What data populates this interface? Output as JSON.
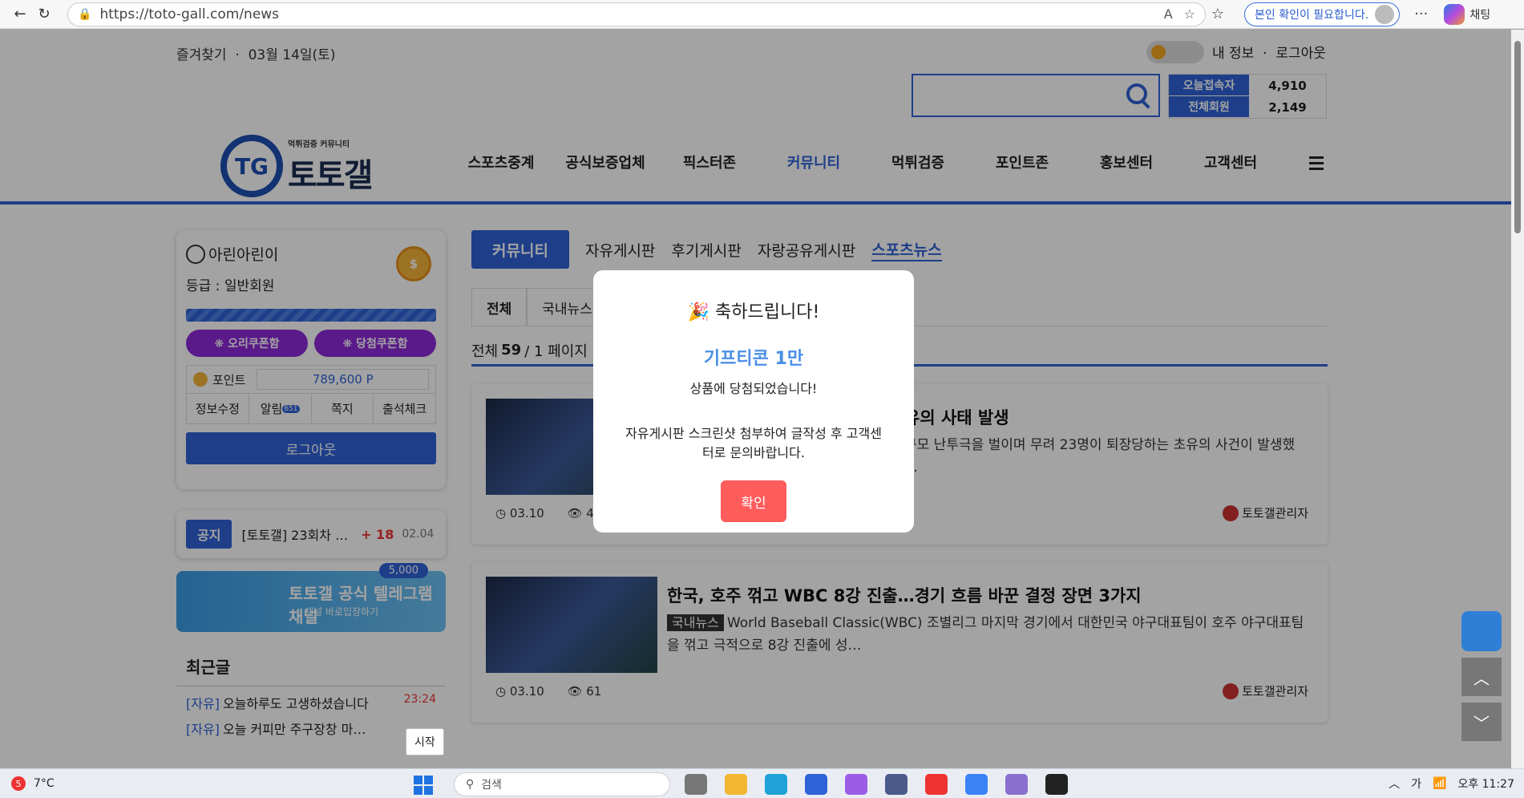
{
  "browser": {
    "url": "https://toto-gall.com/news",
    "verify_label": "본인 확인이 필요합니다.",
    "copilot_label": "채팅"
  },
  "top": {
    "favorites": "즐겨찾기",
    "date": "03월 14일(토)",
    "my_info": "내 정보",
    "logout": "로그아웃",
    "search_placeholder": "",
    "stats": [
      {
        "label": "오늘접속자",
        "value": "4,910"
      },
      {
        "label": "전체회원",
        "value": "2,149"
      }
    ]
  },
  "logo": {
    "sub": "먹튀검증 커뮤니티",
    "main": "토토갤"
  },
  "nav": [
    {
      "label": "스포츠중계"
    },
    {
      "label": "공식보증업체"
    },
    {
      "label": "픽스터존"
    },
    {
      "label": "커뮤니티",
      "active": true
    },
    {
      "label": "먹튀검증"
    },
    {
      "label": "포인트존"
    },
    {
      "label": "홍보센터"
    },
    {
      "label": "고객센터"
    }
  ],
  "profile": {
    "name": "아린아린이",
    "grade": "등급 : 일반회원",
    "coupon1": "❋ 오리쿠폰함",
    "coupon2": "❋ 당첨쿠폰함",
    "point_label": "포인트",
    "point_value": "789,600 P",
    "menu": [
      "정보수정",
      "알림",
      "쪽지",
      "출석체크"
    ],
    "alarm_count": "651",
    "logout_label": "로그아웃"
  },
  "notice": {
    "tag": "공지",
    "text": "[토토갤] 23회차 …",
    "count": "+ 18",
    "date": "02.04"
  },
  "banner": {
    "title": "토토갤 공식 텔레그램 채널",
    "sub": "채널 바로입장하기",
    "badge": "5,000"
  },
  "recent": {
    "title": "최근글",
    "items": [
      {
        "tag": "[자유]",
        "text": "오늘하루도 고생하셨습니다",
        "time": "23:24"
      },
      {
        "tag": "[자유]",
        "text": "오늘 커피만 주구장창 마…",
        "time": ""
      }
    ]
  },
  "content": {
    "cat_main": "커뮤니티",
    "cats": [
      {
        "label": "자유게시판"
      },
      {
        "label": "후기게시판"
      },
      {
        "label": "자랑공유게시판"
      },
      {
        "label": "스포츠뉴스",
        "active": true
      }
    ],
    "subtabs": [
      "전체",
      "국내뉴스"
    ],
    "total_label": "전체",
    "total_count": "59",
    "total_pages": "/ 1 페이지",
    "articles": [
      {
        "title": "유의 사태 발생",
        "desc": "규모 난투극을 벌이며 무려 23명이 퇴장당하는 초유의 사건이 발생했 …",
        "tag": "",
        "date": "03.10",
        "views": "45",
        "author": "토토갤관리자"
      },
      {
        "title": "한국, 호주 꺾고 WBC 8강 진출…경기 흐름 바꾼 결정 장면 3가지",
        "tag": "국내뉴스",
        "desc": "World Baseball Classic(WBC) 조별리그 마지막 경기에서 대한민국 야구대표팀이 호주 야구대표팀을 꺾고 극적으로 8강 진출에 성…",
        "date": "03.10",
        "views": "61",
        "author": "토토갤관리자"
      }
    ]
  },
  "modal": {
    "title": "🎉 축하드립니다!",
    "prize": "기프티콘 1만",
    "line": "상품에 당첨되었습니다!",
    "desc": "자유게시판 스크린샷 첨부하여 글작성 후 고객센터로 문의바랍니다.",
    "ok": "확인"
  },
  "tooltip": "시작",
  "taskbar": {
    "temp": "7°C",
    "weather_badge": "5",
    "search": "검색",
    "ime": "가",
    "time": "오후 11:27"
  },
  "colors": {
    "brand": "#2f62d6",
    "modal_button": "#ff5c5c",
    "prize": "#4a8fe8"
  }
}
